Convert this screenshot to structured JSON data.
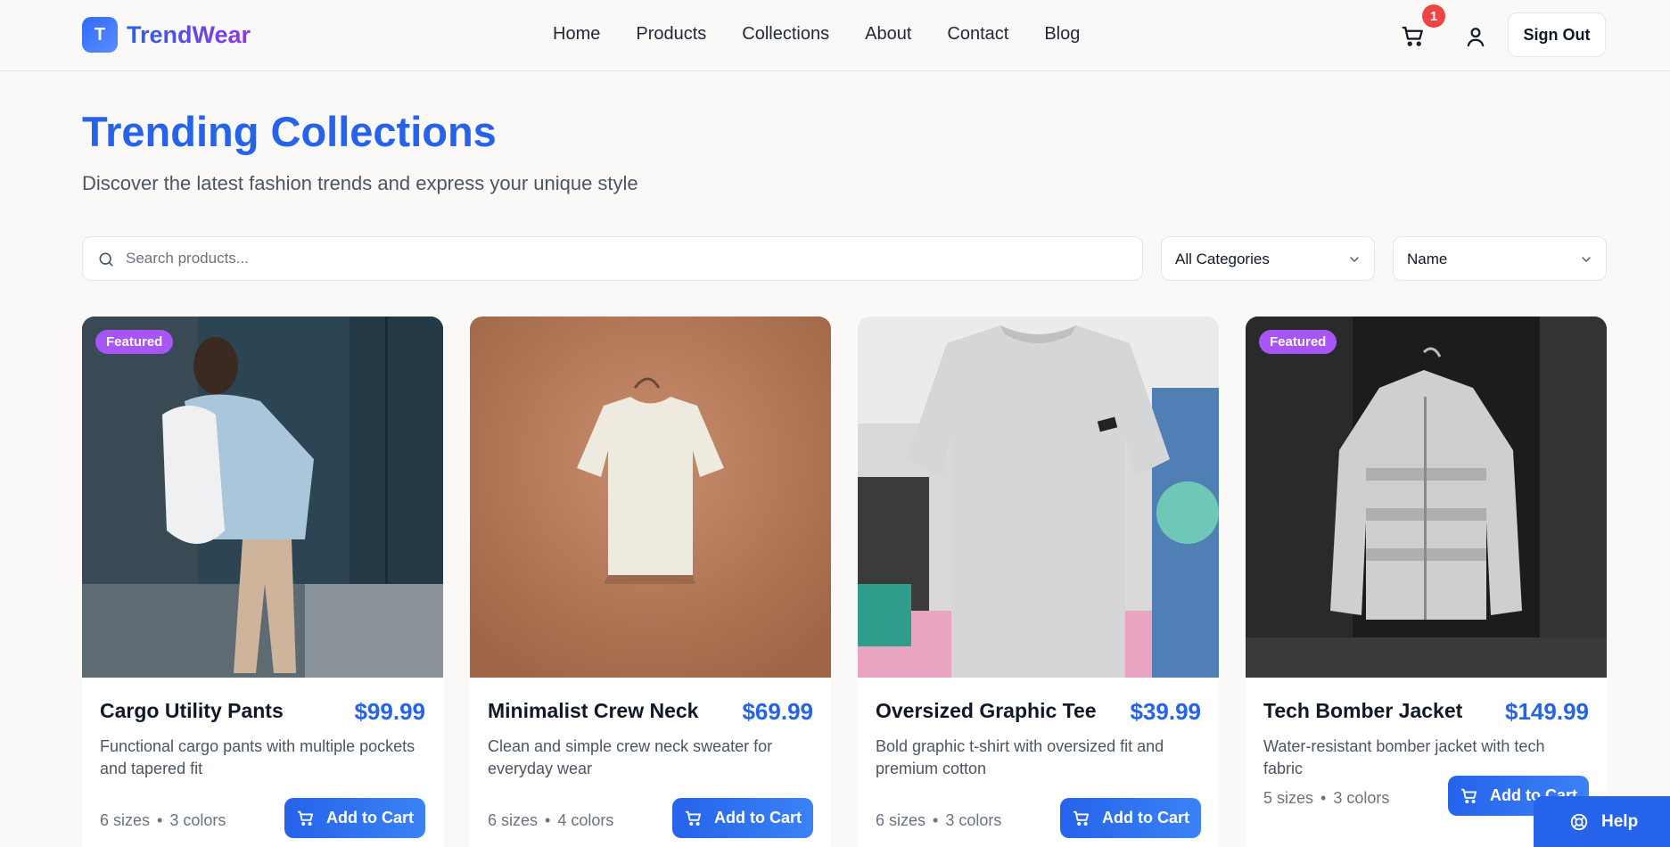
{
  "brand": {
    "initial": "T",
    "name": "TrendWear"
  },
  "nav": [
    "Home",
    "Products",
    "Collections",
    "About",
    "Contact",
    "Blog"
  ],
  "header": {
    "cart_count": "1",
    "sign_out_label": "Sign Out"
  },
  "hero": {
    "title": "Trending Collections",
    "subtitle": "Discover the latest fashion trends and express your unique style"
  },
  "filters": {
    "search_placeholder": "Search products...",
    "category": "All Categories",
    "sort": "Name"
  },
  "products": [
    {
      "name": "Cargo Utility Pants",
      "price": "$99.99",
      "desc": "Functional cargo pants with multiple pockets and tapered fit",
      "sizes": "6 sizes",
      "colors": "3 colors",
      "featured": "Featured",
      "button": "Add to Cart"
    },
    {
      "name": "Minimalist Crew Neck",
      "price": "$69.99",
      "desc": "Clean and simple crew neck sweater for everyday wear",
      "sizes": "6 sizes",
      "colors": "4 colors",
      "featured": "",
      "button": "Add to Cart"
    },
    {
      "name": "Oversized Graphic Tee",
      "price": "$39.99",
      "desc": "Bold graphic t-shirt with oversized fit and premium cotton",
      "sizes": "6 sizes",
      "colors": "3 colors",
      "featured": "",
      "button": "Add to Cart"
    },
    {
      "name": "Tech Bomber Jacket",
      "price": "$149.99",
      "desc": "Water-resistant bomber jacket with tech fabric",
      "sizes": "5 sizes",
      "colors": "3 colors",
      "featured": "Featured",
      "button": "Add to Cart"
    }
  ],
  "help_label": "Help",
  "icons": {
    "cart": "cart-icon",
    "user": "user-icon",
    "search": "search-icon",
    "chevron": "chevron-down-icon",
    "help": "lifebuoy-icon"
  },
  "colors": {
    "accent": "#2563eb",
    "featured": "#a855f7",
    "badge": "#ef4444"
  }
}
